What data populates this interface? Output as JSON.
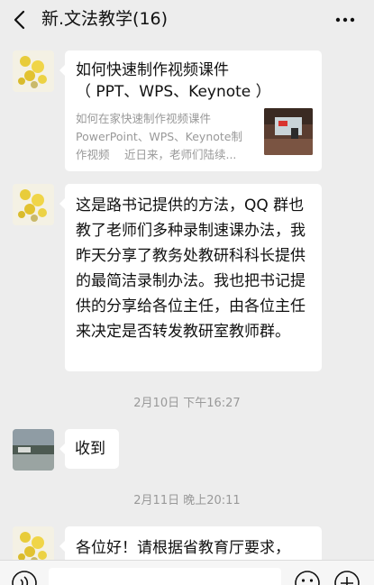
{
  "header": {
    "title": "新.文法教学(16)"
  },
  "messages": {
    "card": {
      "title": "如何快速制作视频课件\n（ PPT、WPS、Keynote ）",
      "description": "如何在家快速制作视频课件\nPowerPoint、WPS、Keynote制\n作视频　 近日来，老师们陆续..."
    },
    "msg2": {
      "text": "这是路书记提供的方法，QQ 群也教了老师们多种录制速课办法，我昨天分享了教务处教研科科长提供的最简洁录制办法。我也把书记提供的分享给各位主任，由各位主任来决定是否转发教研室教师群。"
    },
    "time1": "2月10日 下午16:27",
    "msg3": {
      "text": "收到"
    },
    "time2": "2月11日 晚上20:11",
    "msg4": {
      "text": "各位好！请根据省教育厅要求，"
    }
  },
  "icons": {
    "back": "chevron-left-icon",
    "more": "more-dots-icon",
    "voice": "voice-icon",
    "emoji": "emoji-icon",
    "plus": "plus-icon"
  },
  "colors": {
    "background": "#ededed",
    "bubble": "#ffffff",
    "time_text": "#999999"
  }
}
